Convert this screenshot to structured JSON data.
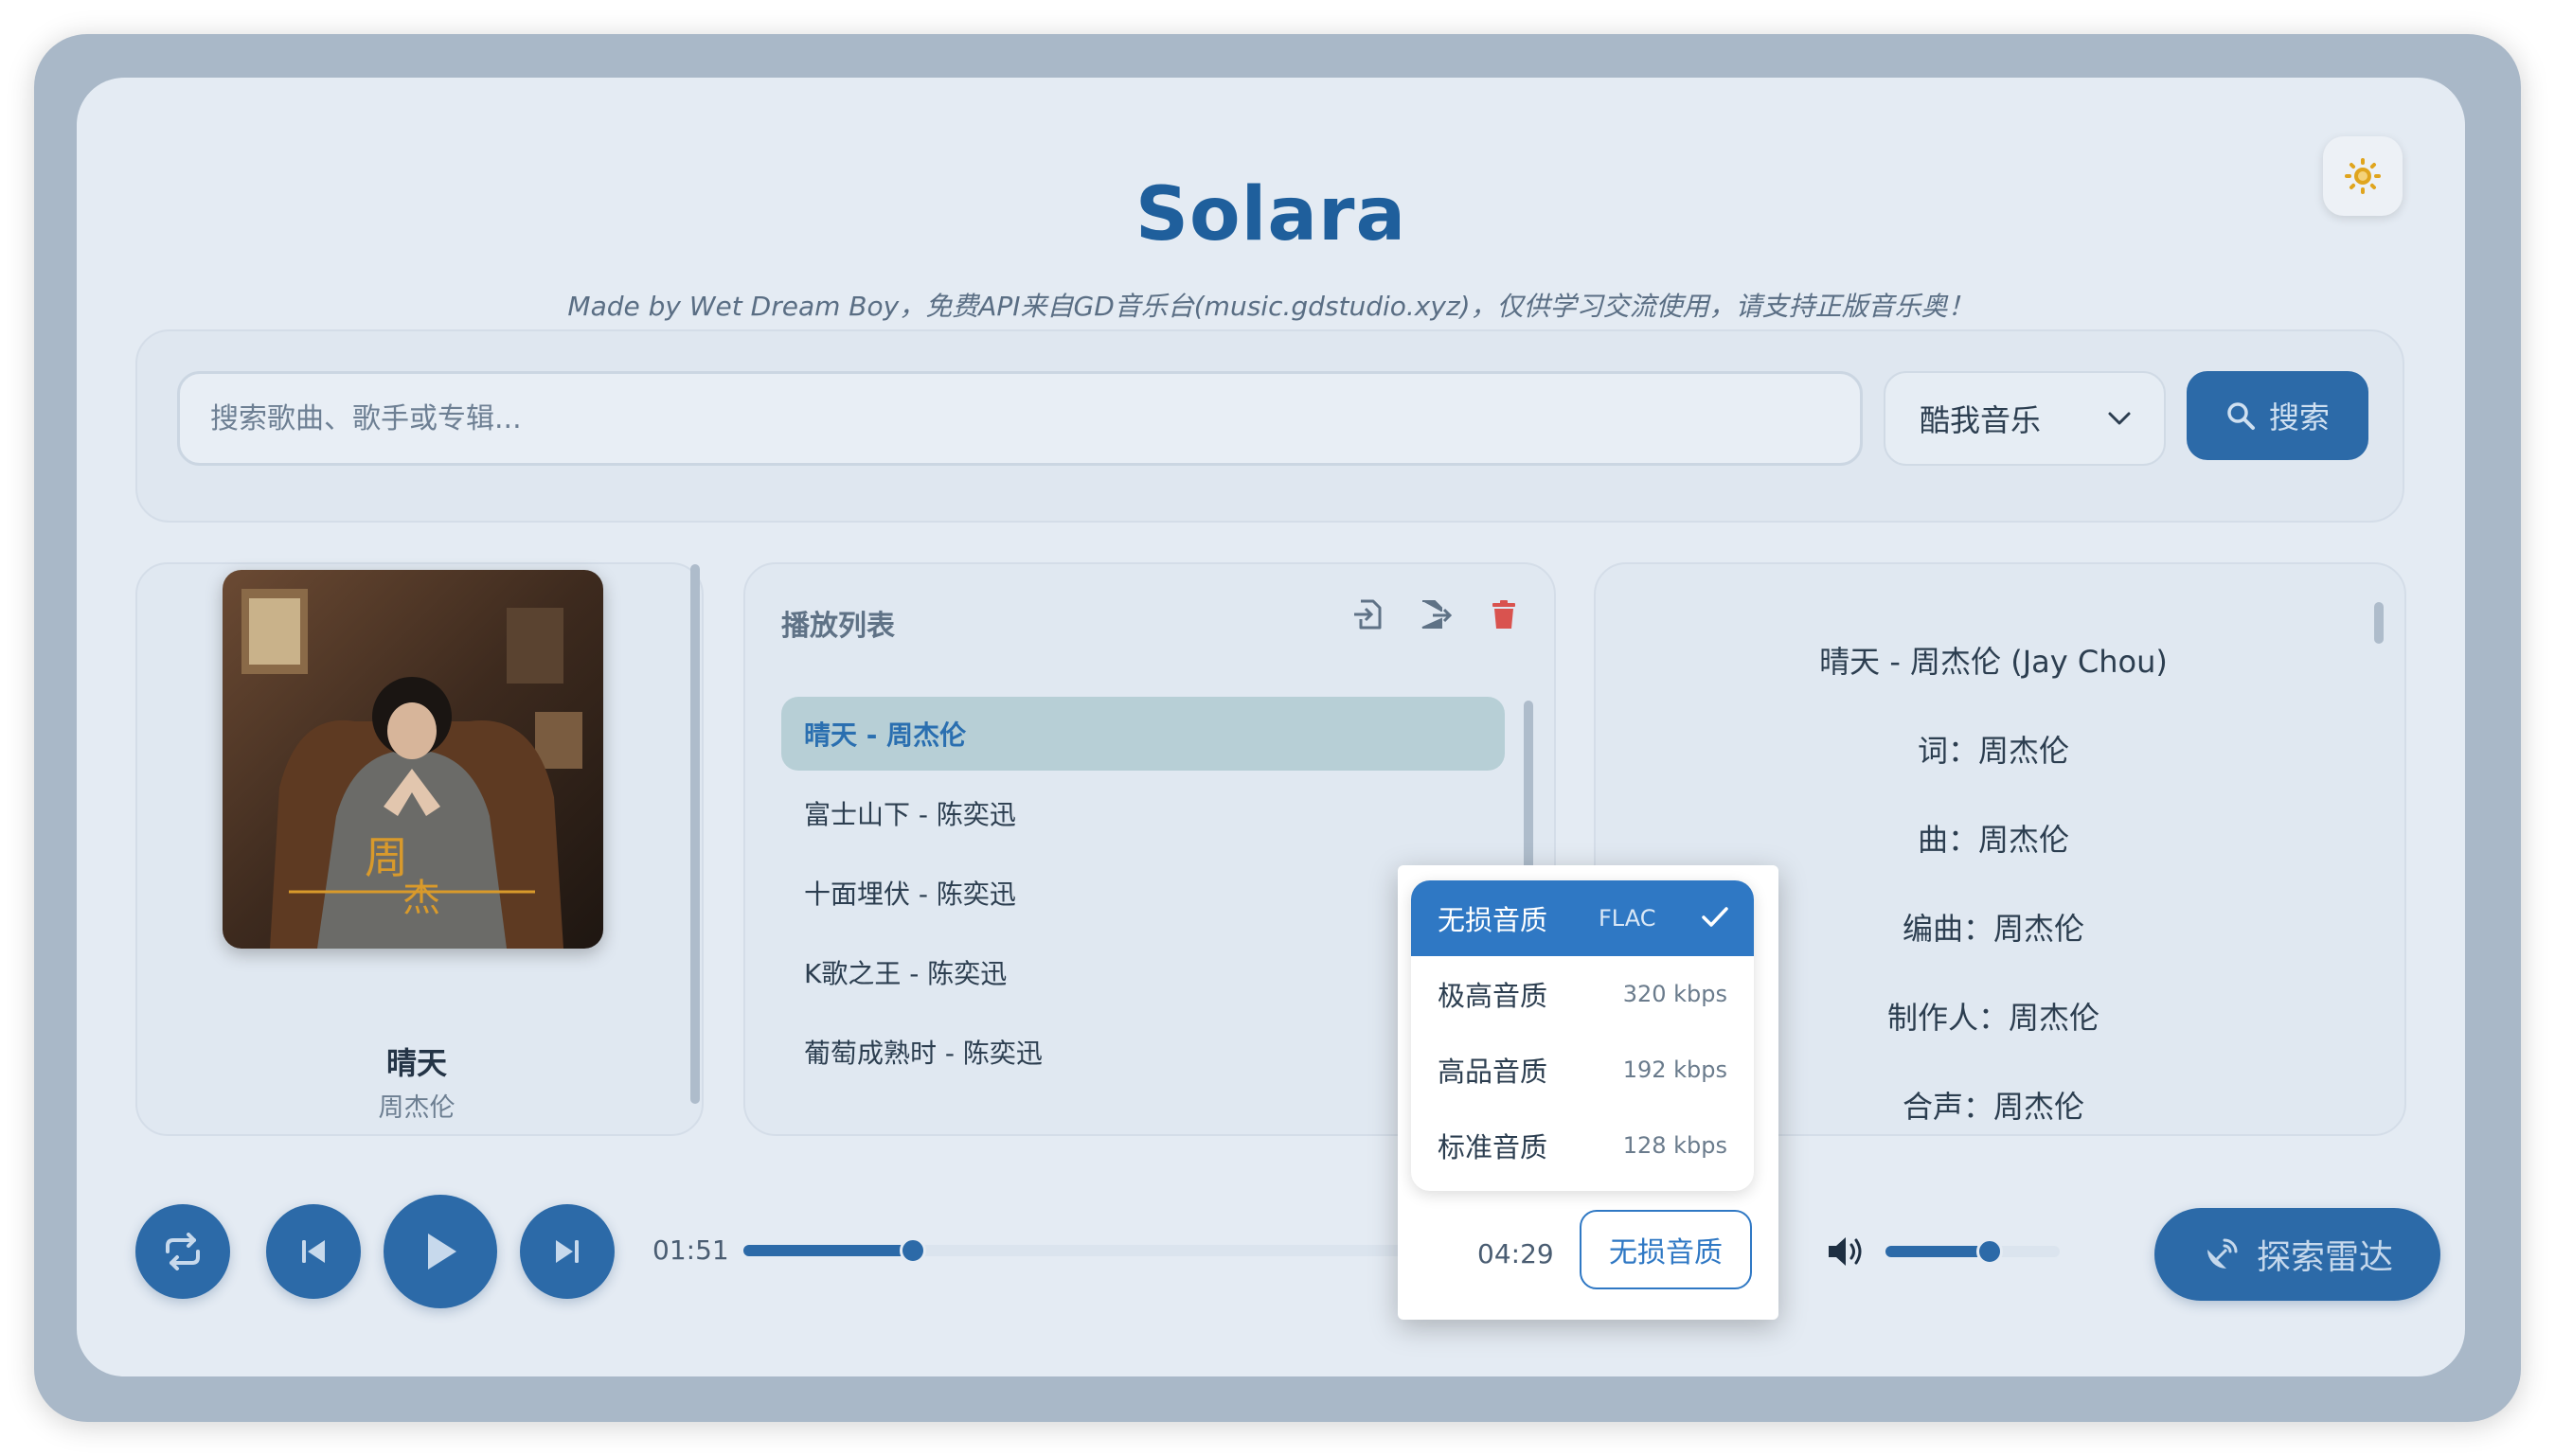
{
  "app": {
    "title": "Solara",
    "subtitle": "Made by Wet Dream Boy，免费API来自GD音乐台(music.gdstudio.xyz)，仅供学习交流使用，请支持正版音乐奥！"
  },
  "search": {
    "placeholder": "搜索歌曲、歌手或专辑...",
    "source": "酷我音乐",
    "button_label": "搜索"
  },
  "now_playing": {
    "title": "晴天",
    "artist": "周杰伦"
  },
  "playlist": {
    "heading": "播放列表",
    "items": [
      {
        "label": "晴天 - 周杰伦",
        "active": true
      },
      {
        "label": "富士山下 - 陈奕迅"
      },
      {
        "label": "十面埋伏 - 陈奕迅"
      },
      {
        "label": "K歌之王 - 陈奕迅"
      },
      {
        "label": "葡萄成熟时 - 陈奕迅"
      }
    ]
  },
  "lyrics": {
    "lines": [
      "晴天 - 周杰伦 (Jay Chou)",
      "词：周杰伦",
      "曲：周杰伦",
      "编曲：周杰伦",
      "制作人：周杰伦",
      "合声：周杰伦"
    ]
  },
  "player": {
    "current_time": "01:51",
    "duration": "04:29",
    "progress": 0.23,
    "volume": 0.6,
    "explore_label": "探索雷达"
  },
  "quality": {
    "options": [
      {
        "label": "无损音质",
        "rate": "FLAC",
        "selected": true
      },
      {
        "label": "极高音质",
        "rate": "320 kbps"
      },
      {
        "label": "高品音质",
        "rate": "192 kbps"
      },
      {
        "label": "标准音质",
        "rate": "128 kbps"
      }
    ],
    "button_label": "无损音质"
  },
  "colors": {
    "accent": "#2c6aa8",
    "title": "#1f5f9c",
    "delete": "#d9534f",
    "theme_icon": "#e0a51e"
  }
}
